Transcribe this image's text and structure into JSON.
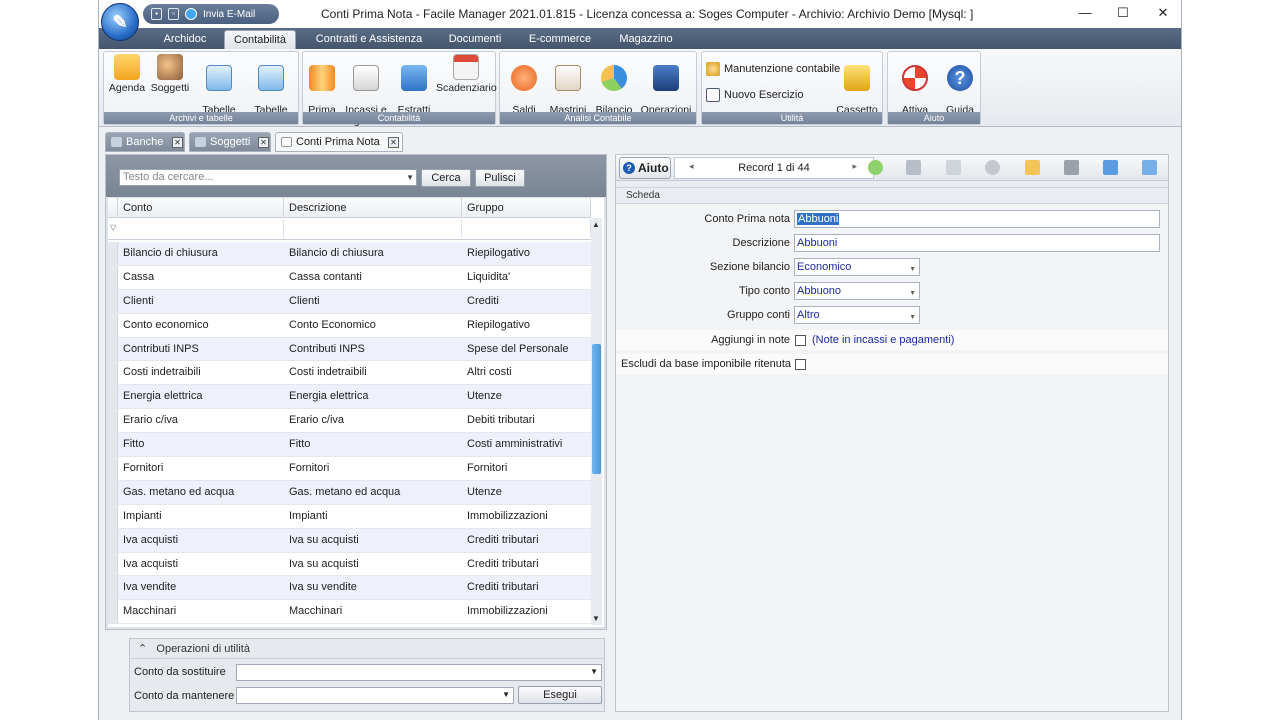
{
  "app": {
    "window_title": "Conti Prima Nota - Facile Manager 2021.01.815 - Licenza concessa a: Soges Computer - Archivio: Archivio Demo  [Mysql: ]",
    "qat_send_email": "Invia E-Mail"
  },
  "ribbon_tabs": [
    "Archidoc",
    "Contabilità",
    "Contratti e Assistenza",
    "Documenti",
    "E-commerce",
    "Magazzino"
  ],
  "ribbon": {
    "archivi": {
      "label": "Archivi e tabelle",
      "buttons": [
        {
          "text": "Agenda",
          "icon": "agenda-icon"
        },
        {
          "text": "Soggetti",
          "icon": "soggetti-icon"
        },
        {
          "text": "Tabelle\nGenerali ▾",
          "icon": "tabelle-generali-icon"
        },
        {
          "text": "Tabelle\nContabili ▾",
          "icon": "tabelle-contabili-icon"
        }
      ]
    },
    "contabilita": {
      "label": "Contabilità",
      "buttons": [
        {
          "text": "Prima\nNota",
          "icon": "prima-nota-icon"
        },
        {
          "text": "Incassi e\nPagamenti",
          "icon": "incassi-pagamenti-icon"
        },
        {
          "text": "Estratti\nconto",
          "icon": "estratti-conto-icon"
        },
        {
          "text": "Scadenziario",
          "icon": "scadenziario-icon"
        }
      ]
    },
    "analisi": {
      "label": "Analisi Contabile",
      "buttons": [
        {
          "text": "Saldi\nContabili",
          "icon": "saldi-contabili-icon"
        },
        {
          "text": "Mastrini\nContabili",
          "icon": "mastrini-contabili-icon"
        },
        {
          "text": "Bilancio\nContabile",
          "icon": "bilancio-contabile-icon"
        },
        {
          "text": "Operazioni\nFiscali ▾",
          "icon": "operazioni-fiscali-icon"
        }
      ]
    },
    "utilita": {
      "label": "Utilità",
      "manutenzione": "Manutenzione contabile",
      "nuovo_esercizio": "Nuovo Esercizio",
      "cassetto": "Cassetto\nCassa ▾"
    },
    "aiuto": {
      "label": "Aiuto",
      "buttons": [
        {
          "text": "Attiva\nAssistenza",
          "icon": "lifebuoy-icon"
        },
        {
          "text": "Guida\nOn line",
          "icon": "help-icon"
        }
      ]
    }
  },
  "doc_tabs": [
    "Banche",
    "Soggetti",
    "Conti Prima Nota"
  ],
  "search": {
    "placeholder": "Testo da cercare...",
    "cerca": "Cerca",
    "pulisci": "Pulisci"
  },
  "grid": {
    "columns": [
      "Conto",
      "Descrizione",
      "Gruppo"
    ],
    "rows": [
      [
        "Bilancio di chiusura",
        "Bilancio di chiusura",
        "Riepilogativo"
      ],
      [
        "Cassa",
        "Cassa contanti",
        "Liquidita'"
      ],
      [
        "Clienti",
        "Clienti",
        "Crediti"
      ],
      [
        "Conto economico",
        "Conto Economico",
        "Riepilogativo"
      ],
      [
        "Contributi INPS",
        "Contributi INPS",
        "Spese del Personale"
      ],
      [
        "Costi indetraibili",
        "Costi indetraibili",
        "Altri costi"
      ],
      [
        "Energia elettrica",
        "Energia elettrica",
        "Utenze"
      ],
      [
        "Erario c/iva",
        "Erario c/iva",
        "Debiti tributari"
      ],
      [
        "Fitto",
        "Fitto",
        "Costi amministrativi"
      ],
      [
        "Fornitori",
        "Fornitori",
        "Fornitori"
      ],
      [
        "Gas. metano ed acqua",
        "Gas. metano ed acqua",
        "Utenze"
      ],
      [
        "Impianti",
        "Impianti",
        "Immobilizzazioni"
      ],
      [
        "Iva acquisti",
        "Iva su acquisti",
        "Crediti tributari"
      ],
      [
        "Iva acquisti",
        "Iva su acquisti",
        "Crediti tributari"
      ],
      [
        "Iva vendite",
        "Iva su vendite",
        "Crediti tributari"
      ],
      [
        "Macchinari",
        "Macchinari",
        "Immobilizzazioni"
      ]
    ]
  },
  "utility": {
    "title": "Operazioni di utilità",
    "conto_da_sostituire": "Conto da sostituire",
    "conto_da_mantenere": "Conto da mantenere",
    "esegui": "Esegui"
  },
  "detail": {
    "aiuto": "Aiuto",
    "record": "Record 1 di 44",
    "scheda": "Scheda",
    "fields": {
      "conto_prima_nota_label": "Conto Prima nota",
      "conto_prima_nota_value": "Abbuoni",
      "descrizione_label": "Descrizione",
      "descrizione_value": "Abbuoni",
      "sezione_bilancio_label": "Sezione bilancio",
      "sezione_bilancio_value": "Economico",
      "tipo_conto_label": "Tipo conto",
      "tipo_conto_value": "Abbuono",
      "gruppo_conti_label": "Gruppo conti",
      "gruppo_conti_value": "Altro",
      "aggiungi_label": "Aggiungi in note",
      "aggiungi_note": "(Note in incassi e pagamenti)",
      "escludi_label": "Escludi da base imponibile ritenuta"
    }
  }
}
